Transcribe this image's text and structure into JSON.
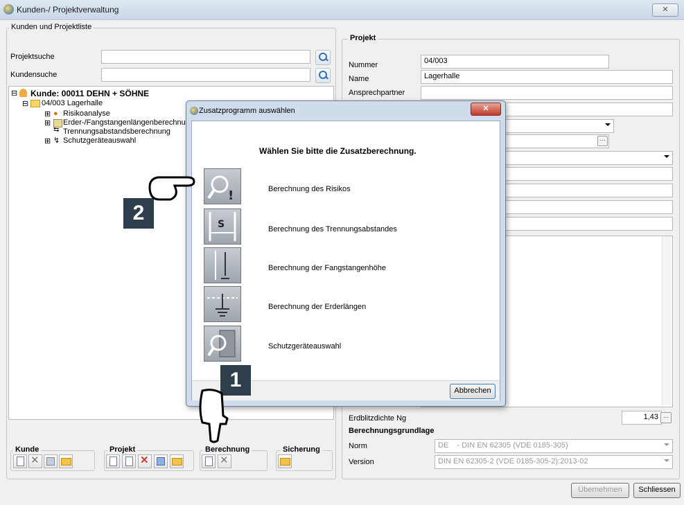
{
  "window": {
    "title": "Kunden-/ Projektverwaltung",
    "close_label": "✕"
  },
  "left": {
    "group_label": "Kunden und Projektliste",
    "project_search_label": "Projektsuche",
    "customer_search_label": "Kundensuche",
    "tree": {
      "customer": "Kunde: 00011 DEHN + SÖHNE",
      "project": "04/003 Lagerhalle",
      "children": [
        "Risikoanalyse",
        "Erder-/Fangstangenlängenberechnu",
        "Trennungsabstandsberechnung",
        "Schutzgeräteauswahl"
      ]
    },
    "toolbar_groups": {
      "kunde": "Kunde",
      "projekt": "Projekt",
      "berechnung": "Berechnung",
      "sicherung": "Sicherung"
    }
  },
  "right": {
    "group_label": "Projekt",
    "nummer_label": "Nummer",
    "nummer_value": "04/003",
    "name_label": "Name",
    "name_value": "Lagerhalle",
    "ansprechpartner_label": "Ansprechpartner",
    "erdblitz_label": "Erdblitzdichte Ng",
    "erdblitz_value": "1,43",
    "berechnungsgrundlage_label": "Berechnungsgrundlage",
    "norm_label": "Norm",
    "norm_value": "DE    - DIN EN 62305 (VDE 0185-305)",
    "version_label": "Version",
    "version_value": "DIN EN 62305-2 (VDE 0185-305-2):2013-02"
  },
  "footer": {
    "uebernehmen": "Übernehmen",
    "schliessen": "Schliessen"
  },
  "dialog": {
    "title": "Zusatzprogramm auswählen",
    "heading": "Wählen Sie bitte die Zusatzberechnung.",
    "options": [
      {
        "label": "Berechnung des Risikos",
        "icon": "risk-icon"
      },
      {
        "label": "Berechnung des Trennungsabstandes",
        "icon": "separation-distance-icon"
      },
      {
        "label": "Berechnung der Fangstangenhöhe",
        "icon": "air-terminal-height-icon"
      },
      {
        "label": "Berechnung der Erderlängen",
        "icon": "earth-electrode-icon"
      },
      {
        "label": "Schutzgeräteauswahl",
        "icon": "protection-device-icon"
      }
    ],
    "cancel": "Abbrechen"
  },
  "annotations": {
    "badge1": "1",
    "badge2": "2"
  }
}
